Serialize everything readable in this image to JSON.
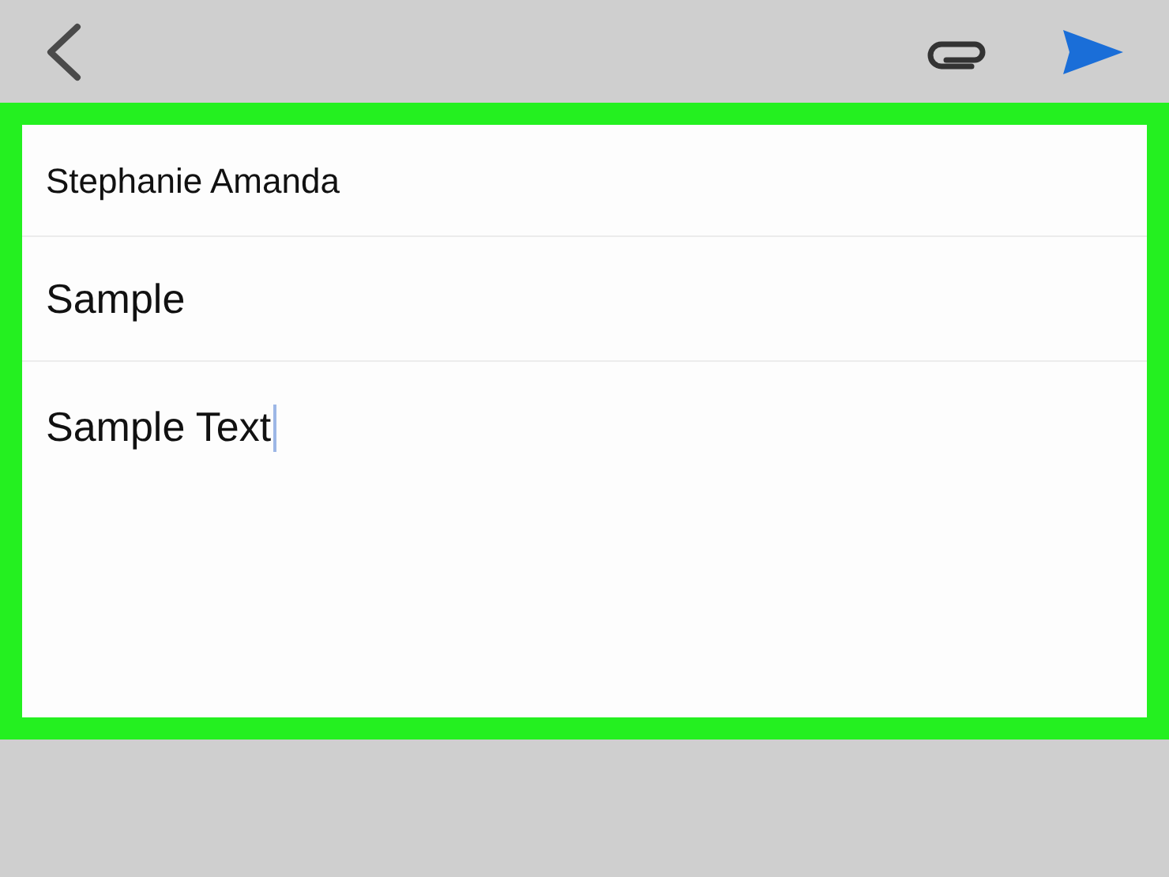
{
  "compose": {
    "to": "Stephanie Amanda",
    "subject": "Sample",
    "body": {
      "value": "Sample Text",
      "focused": true
    }
  }
}
